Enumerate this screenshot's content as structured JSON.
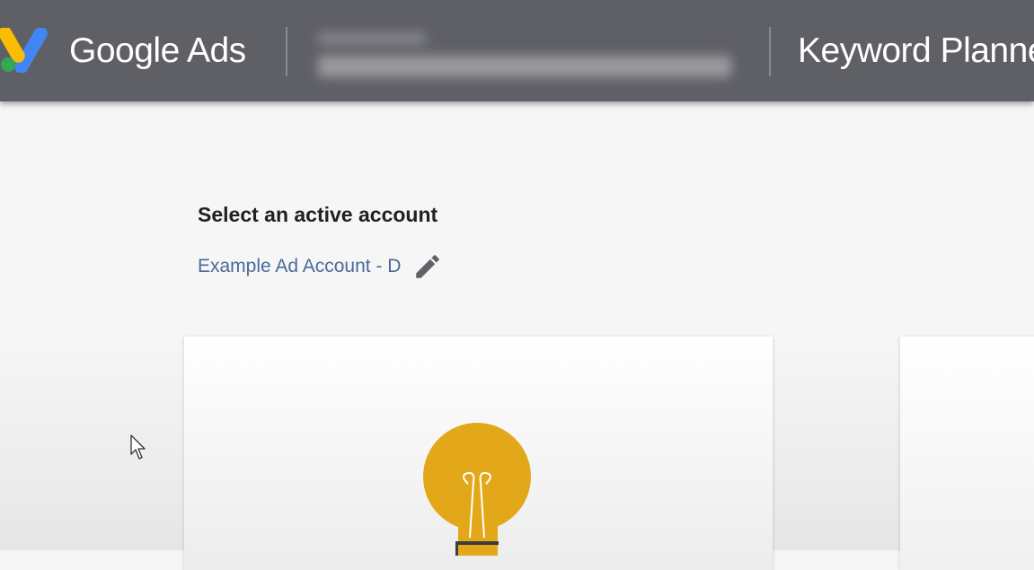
{
  "header": {
    "brand_label": "Google Ads",
    "tool_label": "Keyword Planne",
    "logo_icon": "google-ads-logo-icon",
    "colors": {
      "bar": "#5f6066",
      "logo_blue": "#4285f4",
      "logo_yellow": "#fbbc04",
      "logo_green": "#34a853"
    }
  },
  "account_selector": {
    "title": "Select an active account",
    "account_name": "Example Ad Account - D",
    "edit_icon": "pencil-icon"
  },
  "cards": [
    {
      "icon": "lightbulb-icon",
      "icon_color": "#e3a81a"
    },
    {
      "icon": ""
    }
  ]
}
